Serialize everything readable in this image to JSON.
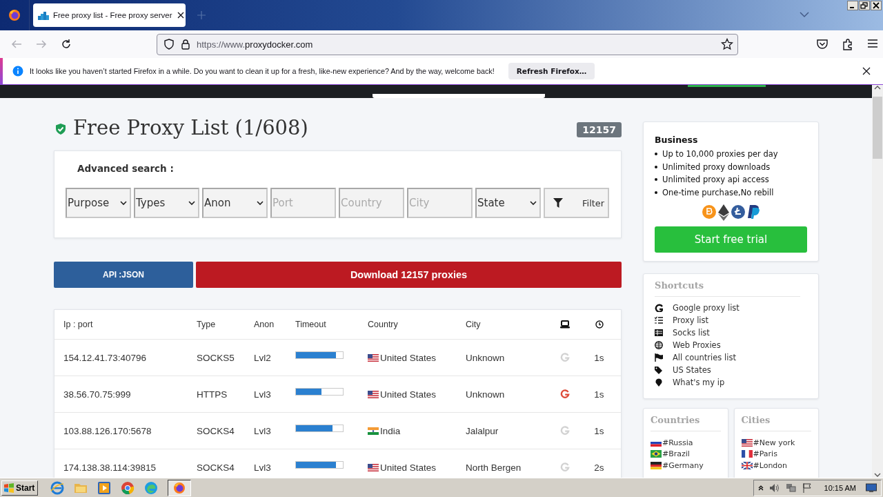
{
  "browser": {
    "tab_title": "Free proxy list - Free proxy server",
    "url_prefix": "https://www.",
    "url_domain": "proxydocker.com",
    "notification": "It looks like you haven’t started Firefox in a while. Do you want to clean it up for a fresh, like-new experience? And by the way, welcome back!",
    "notification_button": "Refresh Firefox…"
  },
  "page": {
    "title": "Free Proxy List (1/608)",
    "count": "12157",
    "search_label": "Advanced search :",
    "filters": [
      {
        "kind": "select",
        "label": "Purpose"
      },
      {
        "kind": "select",
        "label": "Types"
      },
      {
        "kind": "select",
        "label": "Anon"
      },
      {
        "kind": "input",
        "placeholder": "Port"
      },
      {
        "kind": "input",
        "placeholder": "Country"
      },
      {
        "kind": "input",
        "placeholder": "City"
      },
      {
        "kind": "select",
        "label": "State"
      }
    ],
    "filter_button": "Filter",
    "api_button": "API :JSON",
    "download_button": "Download 12157 proxies",
    "table": {
      "columns": [
        "Ip : port",
        "Type",
        "Anon",
        "Timeout",
        "Country",
        "City"
      ],
      "rows": [
        {
          "ip": "154.12.41.73:40796",
          "type": "SOCKS5",
          "anon": "Lvl2",
          "level": 0.85,
          "kind": "us",
          "country": "United States",
          "city": "Unknown",
          "google": false,
          "time": "1s"
        },
        {
          "ip": "38.56.70.75:999",
          "type": "HTTPS",
          "anon": "Lvl3",
          "level": 0.55,
          "kind": "us",
          "country": "United States",
          "city": "Unknown",
          "google": true,
          "time": "1s"
        },
        {
          "ip": "103.88.126.170:5678",
          "type": "SOCKS4",
          "anon": "Lvl3",
          "level": 0.78,
          "kind": "in",
          "country": "India",
          "city": "Jalalpur",
          "google": false,
          "time": "1s"
        },
        {
          "ip": "174.138.38.114:39815",
          "type": "SOCKS4",
          "anon": "Lvl3",
          "level": 0.85,
          "kind": "us",
          "country": "United States",
          "city": "North Bergen",
          "google": false,
          "time": "2s"
        }
      ]
    }
  },
  "sidebar": {
    "business": {
      "title": "Business",
      "features": [
        "Up to 10,000 proxies per day",
        "Unlimited proxy downloads",
        "Unlimited proxy api access",
        "One-time purchase,No rebill"
      ],
      "trial_button": "Start free trial"
    },
    "shortcuts": {
      "title": "Shortcuts",
      "items": [
        {
          "kind": "google",
          "label": "Google proxy list"
        },
        {
          "kind": "list",
          "label": "Proxy list"
        },
        {
          "kind": "table",
          "label": "Socks list"
        },
        {
          "kind": "globe",
          "label": "Web Proxies"
        },
        {
          "kind": "flag",
          "label": "All countries list"
        },
        {
          "kind": "tags",
          "label": "US States"
        },
        {
          "kind": "pin",
          "label": "What's my ip"
        }
      ]
    },
    "countries": {
      "title": "Countries",
      "items": [
        {
          "kind": "ru",
          "label": "#Russia"
        },
        {
          "kind": "br",
          "label": "#Brazil"
        },
        {
          "kind": "de",
          "label": "#Germany"
        }
      ]
    },
    "cities": {
      "title": "Cities",
      "items": [
        {
          "kind": "us",
          "label": "#New york"
        },
        {
          "kind": "fr",
          "label": "#Paris"
        },
        {
          "kind": "gb",
          "label": "#London"
        }
      ]
    }
  },
  "taskbar": {
    "start": "Start",
    "time": "10:15 AM"
  }
}
